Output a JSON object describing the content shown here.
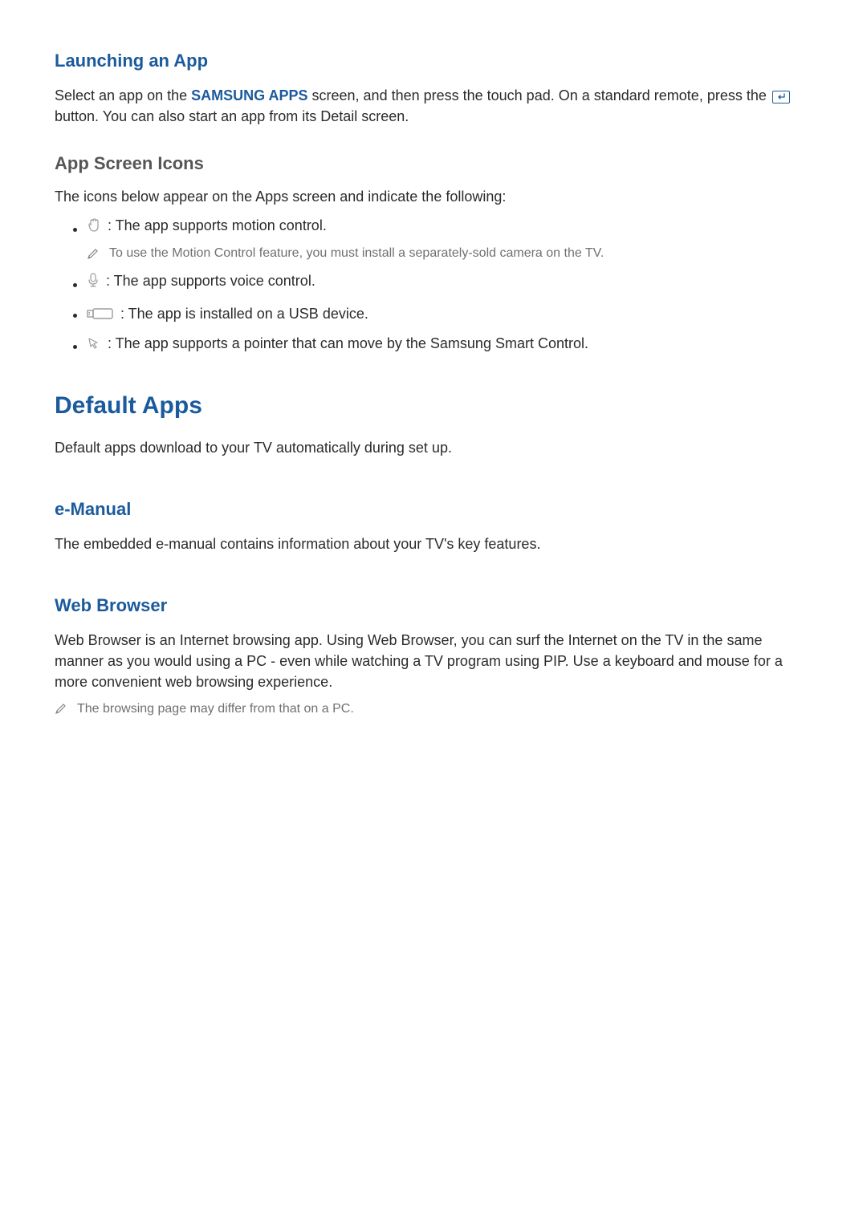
{
  "section_launching": {
    "title": "Launching an App",
    "para_before": "Select an app on the ",
    "samsung_apps_label": "SAMSUNG APPS",
    "para_mid": " screen, and then press the touch pad. On a standard remote, press the ",
    "para_after": " button. You can also start an app from its Detail screen."
  },
  "section_icons": {
    "title": "App Screen Icons",
    "intro": "The icons below appear on the Apps screen and indicate the following:",
    "items": [
      {
        "text": ": The app supports motion control."
      },
      {
        "text": ": The app supports voice control."
      },
      {
        "text": ": The app is installed on a USB device."
      },
      {
        "text": ": The app supports a pointer that can move by the Samsung Smart Control."
      }
    ],
    "motion_note": "To use the Motion Control feature, you must install a separately-sold camera on the TV."
  },
  "section_default": {
    "title": "Default Apps",
    "para": "Default apps download to your TV automatically during set up."
  },
  "section_emanual": {
    "title": "e-Manual",
    "para": "The embedded e-manual contains information about your TV's key features."
  },
  "section_web": {
    "title": "Web Browser",
    "para": "Web Browser is an Internet browsing app. Using Web Browser, you can surf the Internet on the TV in the same manner as you would using a PC - even while watching a TV program using PIP. Use a keyboard and mouse for a more convenient web browsing experience.",
    "note": "The browsing page may differ from that on a PC."
  }
}
